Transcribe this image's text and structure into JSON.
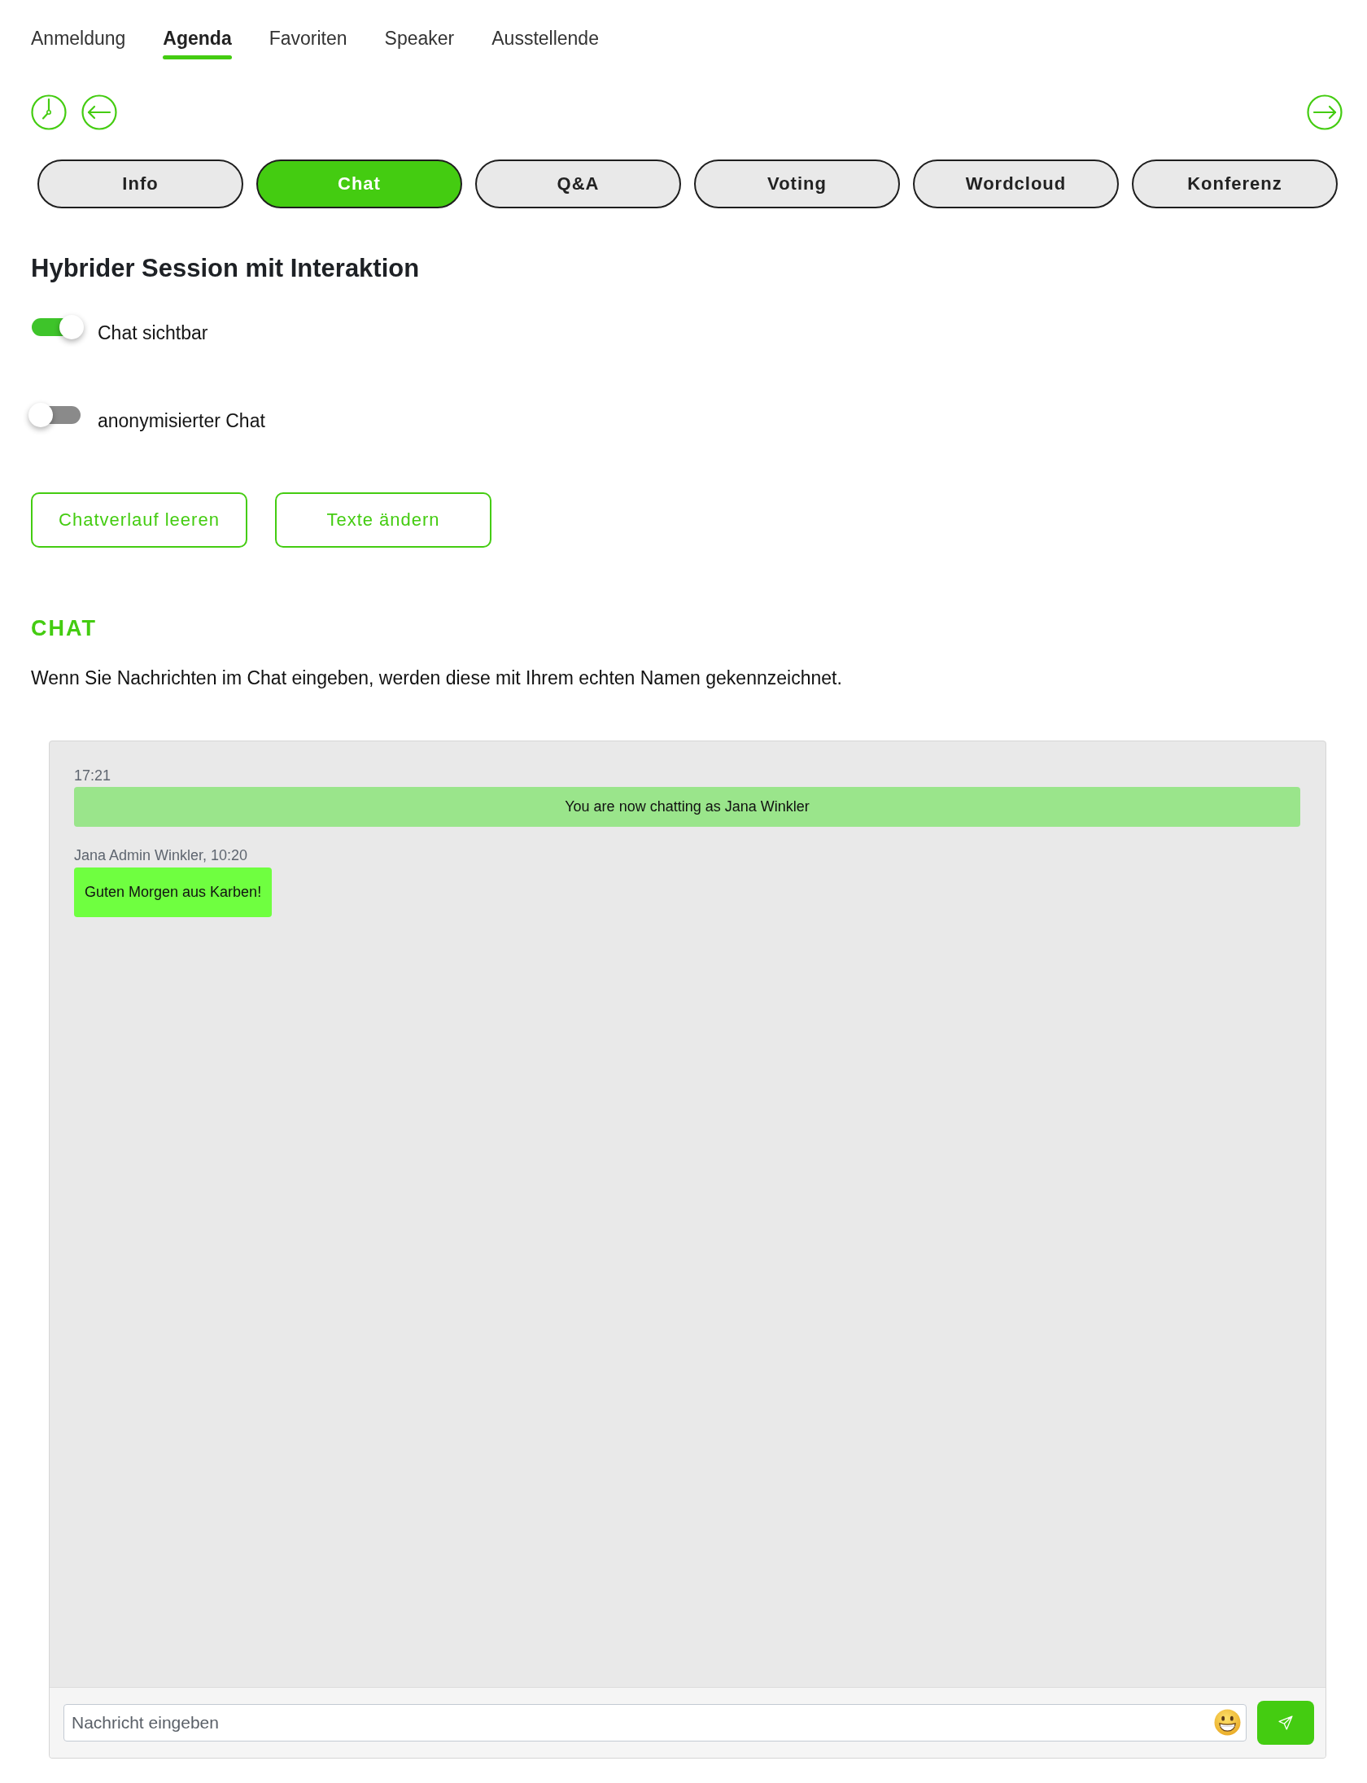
{
  "nav_tabs": [
    {
      "label": "Anmeldung",
      "selected": false
    },
    {
      "label": "Agenda",
      "selected": true
    },
    {
      "label": "Favoriten",
      "selected": false
    },
    {
      "label": "Speaker",
      "selected": false
    },
    {
      "label": "Ausstellende",
      "selected": false
    }
  ],
  "session_tabs": [
    {
      "label": "Info",
      "selected": false
    },
    {
      "label": "Chat",
      "selected": true
    },
    {
      "label": "Q&A",
      "selected": false
    },
    {
      "label": "Voting",
      "selected": false
    },
    {
      "label": "Wordcloud",
      "selected": false
    },
    {
      "label": "Konferenz",
      "selected": false
    }
  ],
  "session": {
    "title": "Hybrider Session mit Interaktion",
    "toggles": [
      {
        "label": "Chat sichtbar",
        "on": true
      },
      {
        "label": "anonymisierter Chat",
        "on": false
      }
    ],
    "buttons": [
      "Chatverlauf leeren",
      "Texte ändern"
    ]
  },
  "chat": {
    "heading": "CHAT",
    "notice": "Wenn Sie Nachrichten im Chat eingeben, werden diese mit Ihrem echten Namen gekennzeichnet.",
    "messages": [
      {
        "kind": "system",
        "header": "17:21",
        "text": "You are now chatting as Jana Winkler"
      },
      {
        "kind": "user",
        "header": "Jana Admin Winkler, 10:20",
        "text": "Guten Morgen aus Karben!"
      }
    ],
    "input": {
      "placeholder": "Nachricht eingeben"
    }
  }
}
